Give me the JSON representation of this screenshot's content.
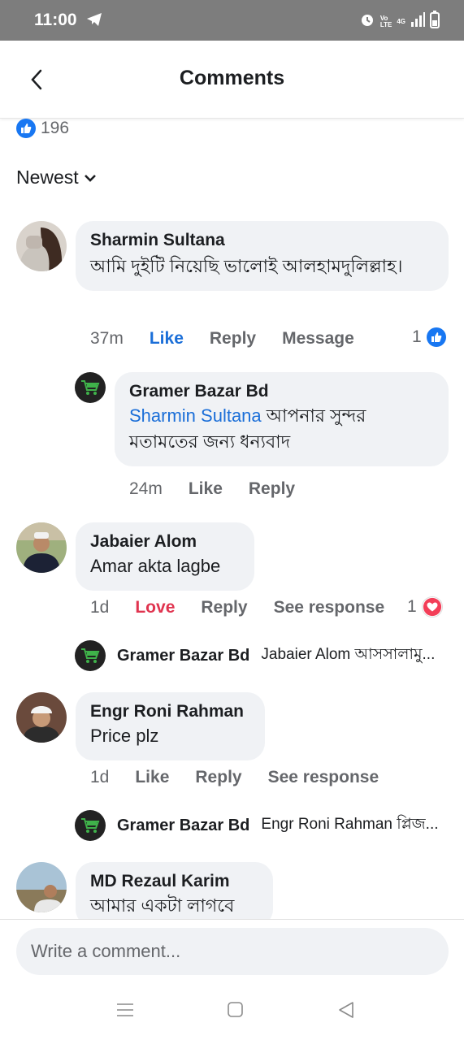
{
  "status_bar": {
    "time": "11:00",
    "net_top": "Vo",
    "net_bottom": "LTE",
    "net_type": "4G"
  },
  "header": {
    "title": "Comments"
  },
  "reactions": {
    "count": "196"
  },
  "sort": {
    "label": "Newest"
  },
  "comments": [
    {
      "name": "Sharmin Sultana",
      "text": "আমি দুইটি নিয়েছি ভালোই আলহামদুলিল্লাহ।",
      "time": "37m",
      "like": "Like",
      "reply": "Reply",
      "extra": "Message",
      "reaction_count": "1",
      "replies": [
        {
          "name": "Gramer Bazar Bd",
          "mention": "Sharmin Sultana",
          "text": "আপনার সুন্দর মতামতের জন্য ধন্যবাদ",
          "time": "24m",
          "like": "Like",
          "reply": "Reply"
        }
      ]
    },
    {
      "name": "Jabaier Alom",
      "text": "Amar akta lagbe",
      "time": "1d",
      "like": "Love",
      "reply": "Reply",
      "extra": "See response",
      "reaction_count": "1",
      "reply_preview": {
        "name": "Gramer Bazar Bd",
        "text": "Jabaier Alom আসসালামু..."
      }
    },
    {
      "name": "Engr Roni Rahman",
      "text": "Price plz",
      "time": "1d",
      "like": "Like",
      "reply": "Reply",
      "extra": "See response",
      "reply_preview": {
        "name": "Gramer Bazar Bd",
        "text": "Engr Roni Rahman প্লিজ..."
      }
    },
    {
      "name": "MD Rezaul Karim",
      "text": "আমার একটা লাগবে"
    }
  ],
  "composer": {
    "placeholder": "Write a comment..."
  },
  "colors": {
    "accent": "#1a6ed8",
    "love": "#e0344f",
    "bubble": "#f0f2f5",
    "status_bar": "#7d7d7d"
  },
  "icons": [
    "telegram-icon",
    "alarm-icon",
    "signal-icon",
    "battery-icon",
    "back-arrow-icon",
    "like-icon",
    "chevron-down-icon",
    "heart-icon",
    "cart-icon",
    "menu-icon",
    "home-square-icon",
    "back-triangle-icon"
  ]
}
